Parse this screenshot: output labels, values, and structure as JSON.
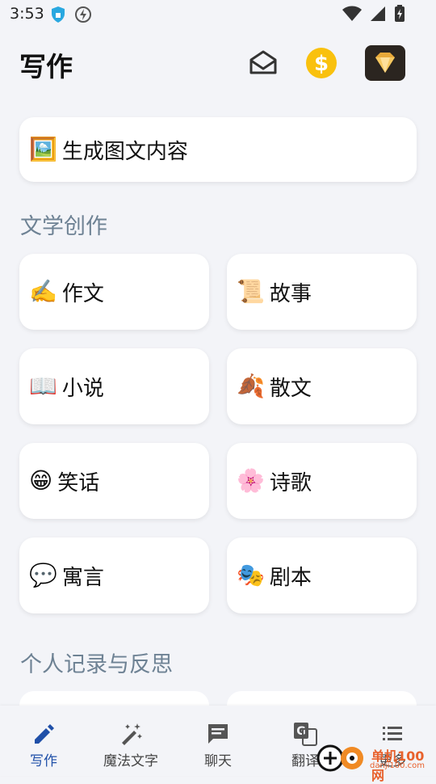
{
  "status_bar": {
    "time": "3:53"
  },
  "header": {
    "title": "写作",
    "mail_icon": "mail-open-icon",
    "coin_icon": "dollar-coin-icon",
    "vip_icon": "diamond-icon"
  },
  "featured": {
    "emoji": "🖼️",
    "label": "生成图文内容"
  },
  "sections": [
    {
      "title": "文学创作",
      "items": [
        {
          "emoji": "✍️",
          "label": "作文"
        },
        {
          "emoji": "📜",
          "label": "故事"
        },
        {
          "emoji": "📖",
          "label": "小说"
        },
        {
          "emoji": "🍂",
          "label": "散文"
        },
        {
          "emoji": "😁",
          "label": "笑话"
        },
        {
          "emoji": "🌸",
          "label": "诗歌"
        },
        {
          "emoji": "💬",
          "label": "寓言"
        },
        {
          "emoji": "🎭",
          "label": "剧本"
        }
      ]
    },
    {
      "title": "个人记录与反思"
    }
  ],
  "bottom_nav": [
    {
      "label": "写作",
      "icon": "pen-icon",
      "active": true
    },
    {
      "label": "魔法文字",
      "icon": "magic-wand-icon"
    },
    {
      "label": "聊天",
      "icon": "chat-icon"
    },
    {
      "label": "翻译",
      "icon": "translate-icon"
    },
    {
      "label": "更多",
      "icon": "list-icon"
    }
  ],
  "watermark": {
    "text": "单机100网",
    "sub": "danji100.com"
  },
  "colors": {
    "background": "#F3F4F8",
    "section_title": "#6E8294",
    "active_nav": "#1F4FA8",
    "coin": "#F9C10E"
  }
}
